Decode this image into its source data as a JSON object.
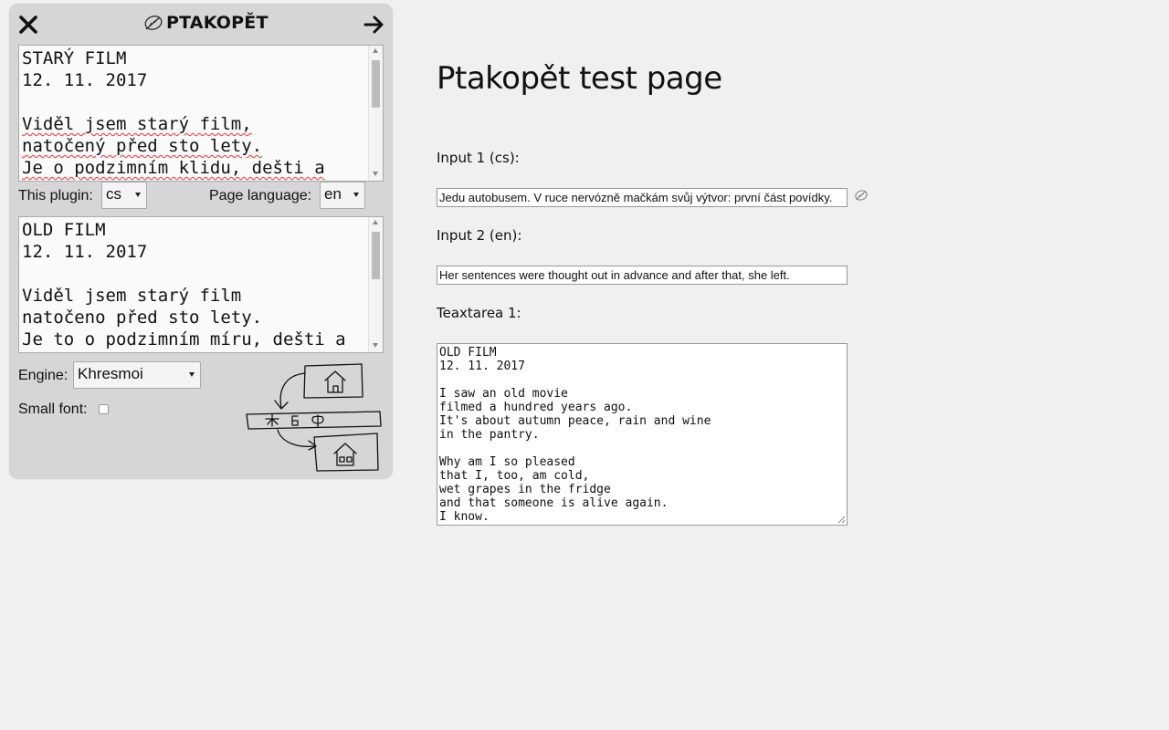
{
  "plugin": {
    "name": "PTAKOPĚT",
    "source_text": {
      "lines": [
        "STARÝ FILM",
        "12. 11. 2017",
        "",
        "Viděl jsem starý film,",
        "natočený před sto lety.",
        "Je o podzimním klidu, dešti a"
      ]
    },
    "this_plugin_label": "This plugin:",
    "this_plugin_value": "cs",
    "page_language_label": "Page language:",
    "page_language_value": "en",
    "output_text": {
      "lines": [
        "OLD FILM",
        "12. 11. 2017",
        "",
        "Viděl jsem starý film",
        "natočeno před sto lety.",
        "Je to o podzimním míru, dešti a"
      ]
    },
    "engine_label": "Engine:",
    "engine_value": "Khresmoi",
    "small_font_label": "Small font:",
    "small_font_checked": false,
    "sketch_letters": "Б Ф"
  },
  "page": {
    "title": "Ptakopět test page",
    "input1_label": "Input 1 (cs):",
    "input1_value": "Jedu autobusem. V ruce nervózně mačkám svůj výtvor: první část povídky.",
    "input2_label": "Input 2 (en):",
    "input2_value": "Her sentences were thought out in advance and after that, she left.",
    "textarea1_label": "Teaxtarea 1:",
    "textarea1_value": "OLD FILM\n12. 11. 2017\n\nI saw an old movie\nfilmed a hundred years ago.\nIt's about autumn peace, rain and wine\nin the pantry.\n\nWhy am I so pleased\nthat I, too, am cold,\nwet grapes in the fridge\nand that someone is alive again.\nI know."
  },
  "icons": {
    "close": "close-icon",
    "arrow": "arrow-right-icon",
    "logo": "feather-icon",
    "field_icon": "feather-icon"
  }
}
